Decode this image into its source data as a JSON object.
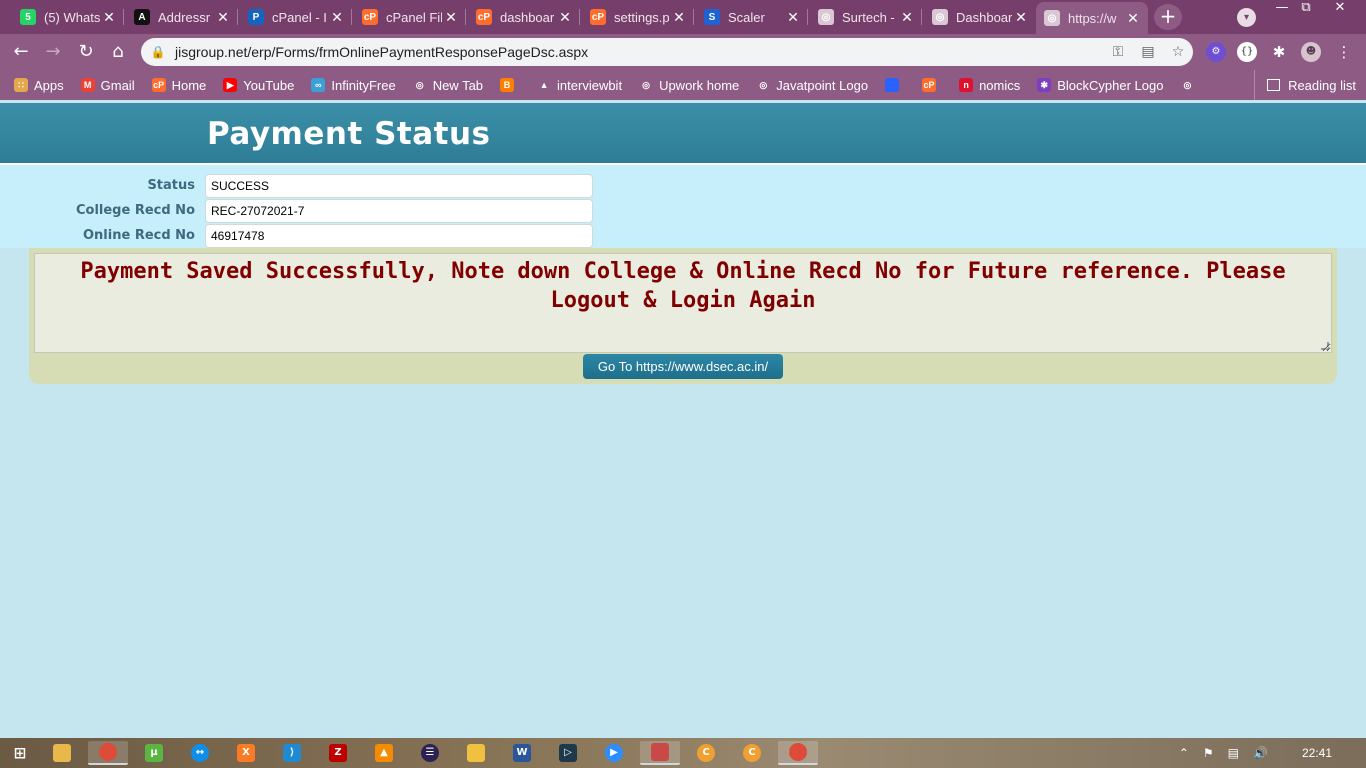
{
  "browser": {
    "tabs": [
      {
        "title": "(5) Whats",
        "icon": "whatsapp-icon",
        "color": "#25d366",
        "glyph": "5"
      },
      {
        "title": "Addressr",
        "icon": "a-letter-icon",
        "color": "#111111",
        "glyph": "A"
      },
      {
        "title": "cPanel - I",
        "icon": "paypal-icon",
        "color": "#1565c0",
        "glyph": "P"
      },
      {
        "title": "cPanel Fil",
        "icon": "cpanel-icon",
        "color": "#ff6c2c",
        "glyph": "cP"
      },
      {
        "title": "dashboar",
        "icon": "cpanel-icon",
        "color": "#ff6c2c",
        "glyph": "cP"
      },
      {
        "title": "settings.p",
        "icon": "cpanel-icon",
        "color": "#ff6c2c",
        "glyph": "cP"
      },
      {
        "title": "Scaler",
        "icon": "scaler-icon",
        "color": "#1e63d6",
        "glyph": "S"
      },
      {
        "title": "Surtech -",
        "icon": "globe-icon",
        "color": "#d9c8d4",
        "glyph": "◎"
      },
      {
        "title": "Dashboar",
        "icon": "globe-icon",
        "color": "#d9c8d4",
        "glyph": "◎"
      },
      {
        "title": "https://w",
        "icon": "globe-icon",
        "color": "#d9c8d4",
        "glyph": "◎"
      }
    ],
    "url": "jisgroup.net/erp/Forms/frmOnlinePaymentResponsePageDsc.aspx",
    "bookmarks": [
      {
        "label": "Apps",
        "icon": "apps-grid-icon",
        "color": "#e3a84c",
        "glyph": "∷"
      },
      {
        "label": "Gmail",
        "icon": "gmail-icon",
        "color": "#ea4335",
        "glyph": "M"
      },
      {
        "label": "Home",
        "icon": "cpanel-icon",
        "color": "#ff6c2c",
        "glyph": "cP"
      },
      {
        "label": "YouTube",
        "icon": "youtube-icon",
        "color": "#ff0000",
        "glyph": "▶"
      },
      {
        "label": "InfinityFree",
        "icon": "infinity-icon",
        "color": "#3aa0d8",
        "glyph": "∞"
      },
      {
        "label": "New Tab",
        "icon": "globe-icon",
        "color": "#8e5b85",
        "glyph": "◎"
      },
      {
        "label": "",
        "icon": "blogger-icon",
        "color": "#ff8000",
        "glyph": "B"
      },
      {
        "label": "interviewbit",
        "icon": "interviewbit-icon",
        "color": "#8e5b85",
        "glyph": "▲"
      },
      {
        "label": "Upwork home",
        "icon": "globe-icon",
        "color": "#8e5b85",
        "glyph": "◎"
      },
      {
        "label": "Javatpoint Logo",
        "icon": "globe-icon",
        "color": "#8e5b85",
        "glyph": "◎"
      },
      {
        "label": "",
        "icon": "bookmark-blue-icon",
        "color": "#2962ff",
        "glyph": ""
      },
      {
        "label": "",
        "icon": "cpanel-icon",
        "color": "#ff6c2c",
        "glyph": "cP"
      },
      {
        "label": "nomics",
        "icon": "nomics-icon",
        "color": "#e0102f",
        "glyph": "n"
      },
      {
        "label": "BlockCypher Logo",
        "icon": "blockcypher-icon",
        "color": "#7b3fbf",
        "glyph": "✱"
      },
      {
        "label": "",
        "icon": "globe-icon",
        "color": "#8e5b85",
        "glyph": "◎"
      }
    ],
    "reading_list": "Reading list"
  },
  "page": {
    "title": "Payment Status",
    "fields": [
      {
        "label": "Status",
        "value": "SUCCESS"
      },
      {
        "label": "College Recd No",
        "value": "REC-27072021-7"
      },
      {
        "label": "Online Recd No",
        "value": "46917478"
      }
    ],
    "message": "Payment Saved Successfully, Note down College & Online Recd No for Future reference. Please Logout & Login Again",
    "button_label": "Go To https://www.dsec.ac.in/"
  },
  "taskbar": {
    "clock": "22:41"
  },
  "colors": {
    "header": "#3588a2",
    "form_bg": "#c6eefb",
    "message_text": "#800000",
    "button": "#2483a3"
  }
}
